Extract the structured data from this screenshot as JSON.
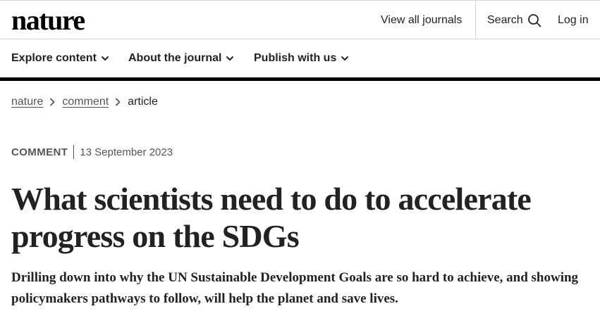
{
  "header": {
    "logo": "nature",
    "view_all_journals": "View all journals",
    "search_label": "Search",
    "login_label": "Log in"
  },
  "nav": {
    "explore": "Explore content",
    "about": "About the journal",
    "publish": "Publish with us"
  },
  "breadcrumb": {
    "items": [
      "nature",
      "comment"
    ],
    "current": "article"
  },
  "article": {
    "type": "COMMENT",
    "date": "13 September 2023",
    "title": "What scientists need to do to accelerate progress on the SDGs",
    "standfirst": "Drilling down into why the UN Sustainable Development Goals are so hard to achieve, and showing policymakers pathways to follow, will help the planet and save lives."
  },
  "icons": {
    "search": "search-icon",
    "chevron_down": "chevron-down-icon",
    "chevron_right": "chevron-right-icon"
  }
}
